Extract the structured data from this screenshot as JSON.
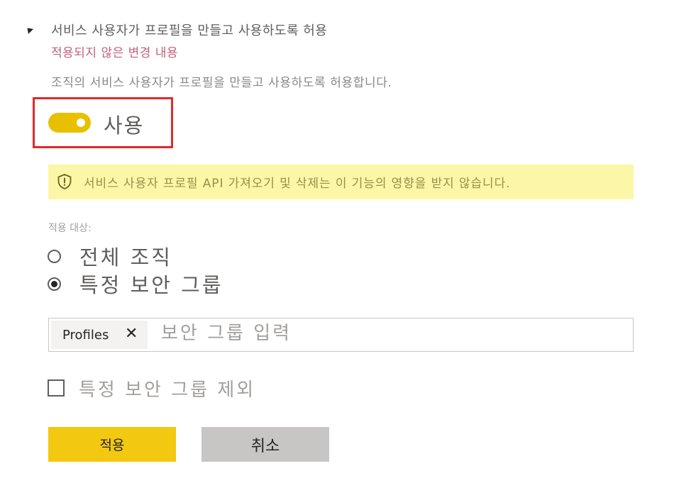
{
  "setting": {
    "title": "서비스 사용자가 프로필을 만들고 사용하도록 허용",
    "unapplied_note": "적용되지 않은 변경 내용",
    "description": "조직의 서비스 사용자가 프로필을 만들고 사용하도록 허용합니다."
  },
  "toggle": {
    "label": "사용",
    "state": "on",
    "color": "#e8c000"
  },
  "info_banner": {
    "icon": "shield-icon",
    "text": "서비스 사용자 프로필 API 가져오기 및 삭제는 이 기능의 영향을 받지 않습니다.",
    "background": "#fbf7a6"
  },
  "applies_to": {
    "label": "적용 대상:",
    "options": [
      {
        "label": "전체 조직",
        "selected": false
      },
      {
        "label": "특정 보안 그룹",
        "selected": true
      }
    ]
  },
  "security_group_input": {
    "chips": [
      {
        "label": "Profiles",
        "remove_icon": "close-icon"
      }
    ],
    "placeholder": "보안 그룹 입력"
  },
  "exclude": {
    "label": "특정 보안 그룹 제외",
    "checked": false
  },
  "buttons": {
    "apply_label": "적용",
    "cancel_label": "취소"
  },
  "colors": {
    "highlight_border": "#e02a2a",
    "apply_button": "#f2c811",
    "cancel_button": "#c8c6c4",
    "unapplied_text": "#c26178"
  }
}
